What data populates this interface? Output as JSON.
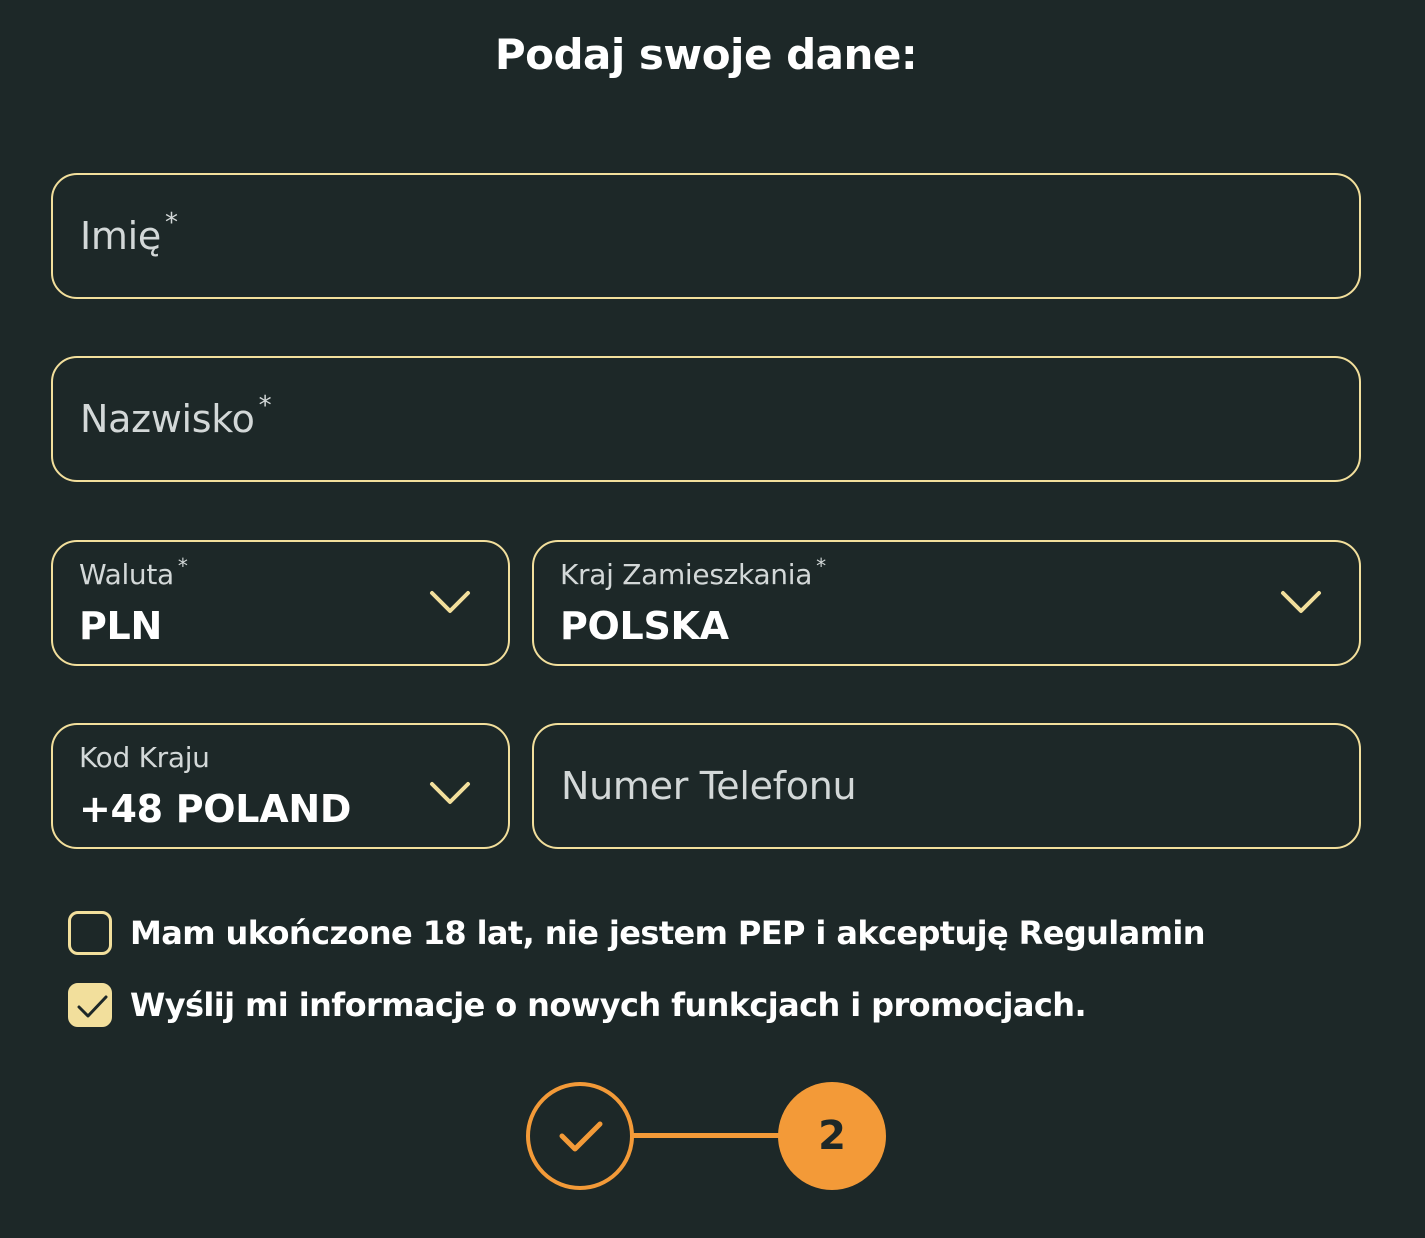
{
  "form": {
    "title": "Podaj swoje dane:",
    "first_name": {
      "placeholder": "Imię",
      "required_mark": "*"
    },
    "last_name": {
      "placeholder": "Nazwisko",
      "required_mark": "*"
    },
    "currency": {
      "label": "Waluta",
      "required_mark": "*",
      "value": "PLN"
    },
    "country": {
      "label": "Kraj Zamieszkania",
      "required_mark": "*",
      "value": "POLSKA"
    },
    "country_code": {
      "label": "Kod Kraju",
      "value": "+48 POLAND"
    },
    "phone": {
      "placeholder": "Numer Telefonu"
    },
    "checkboxes": [
      {
        "label": "Mam ukończone 18 lat, nie jestem PEP i akceptuję Regulamin",
        "checked": false
      },
      {
        "label": "Wyślij mi informacje o nowych funkcjach i promocjach.",
        "checked": true
      }
    ]
  },
  "stepper": {
    "current_step": "2",
    "completed_icon": "check-icon"
  },
  "colors": {
    "background": "#1d2828",
    "field_border": "#f2df9c",
    "accent": "#f39a38",
    "text": "#ffffff",
    "muted_text": "#d3d8d8"
  }
}
